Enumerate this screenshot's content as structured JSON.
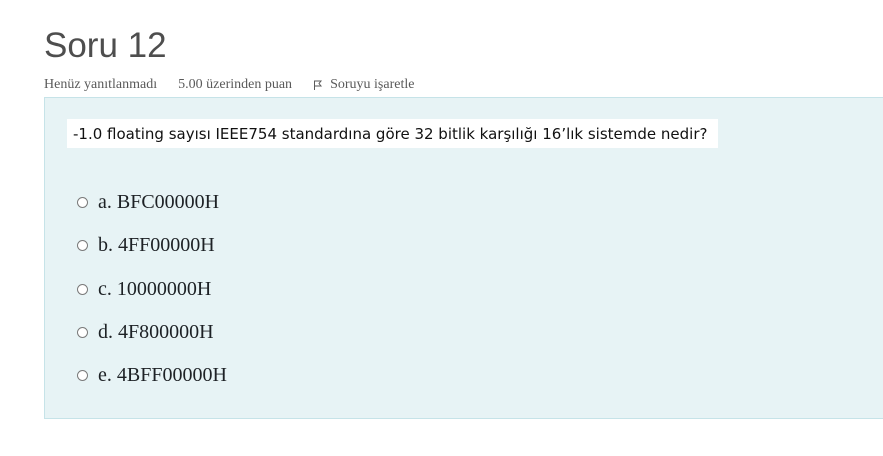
{
  "question": {
    "title": "Soru 12",
    "status": "Henüz yanıtlanmadı",
    "grade": "5.00 üzerinden puan",
    "flag_label": "Soruyu işaretle",
    "text": "-1.0 floating sayısı IEEE754 standardına göre 32 bitlik karşılığı 16’lık sistemde nedir?",
    "answers": [
      {
        "label": "a. BFC00000H"
      },
      {
        "label": "b. 4FF00000H"
      },
      {
        "label": "c. 10000000H"
      },
      {
        "label": "d. 4F800000H"
      },
      {
        "label": "e. 4BFF00000H"
      }
    ]
  },
  "icons": {
    "flag": "flag-outline-icon",
    "radio": "radio-empty-icon"
  },
  "colors": {
    "panel_background": "#e7f3f5",
    "panel_border": "#c6e3e8",
    "title_text": "#4e4e4e",
    "info_text": "#5a5a5a"
  }
}
